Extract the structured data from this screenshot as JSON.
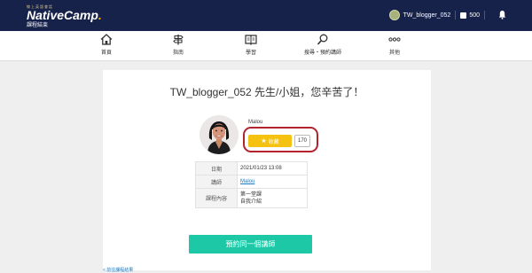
{
  "header": {
    "logo_tag": "線上英語會話",
    "logo_name": "NativeCamp",
    "logo_dot": ".",
    "logo_sub": "課程結束",
    "username": "TW_blogger_052",
    "coins": "500"
  },
  "nav": {
    "items": [
      {
        "label": "首頁",
        "icon": "home-icon"
      },
      {
        "label": "指南",
        "icon": "signpost-icon"
      },
      {
        "label": "學習",
        "icon": "book-icon"
      },
      {
        "label": "搜尋・預約講師",
        "icon": "search-icon"
      },
      {
        "label": "其他",
        "icon": "more-icon"
      }
    ]
  },
  "main": {
    "title": "TW_blogger_052 先生/小姐，您辛苦了！",
    "teacher_name": "Malou",
    "favorite_label": "收藏",
    "favorite_count": "170",
    "table": {
      "rows": [
        {
          "label": "日期",
          "value": "2021/01/23 13:08"
        },
        {
          "label": "講師",
          "value": "Malou"
        },
        {
          "label": "課程內容",
          "value_line1": "第一堂課",
          "value_line2": "自我介紹"
        }
      ]
    },
    "reserve_button": "預約同一個講師",
    "bottom_link": "< 前往課程結果"
  },
  "colors": {
    "header_bg": "#17224a",
    "favorite": "#f5c211",
    "highlight": "#b3232c",
    "reserve": "#1cc8a5",
    "link": "#1a7bc2"
  }
}
